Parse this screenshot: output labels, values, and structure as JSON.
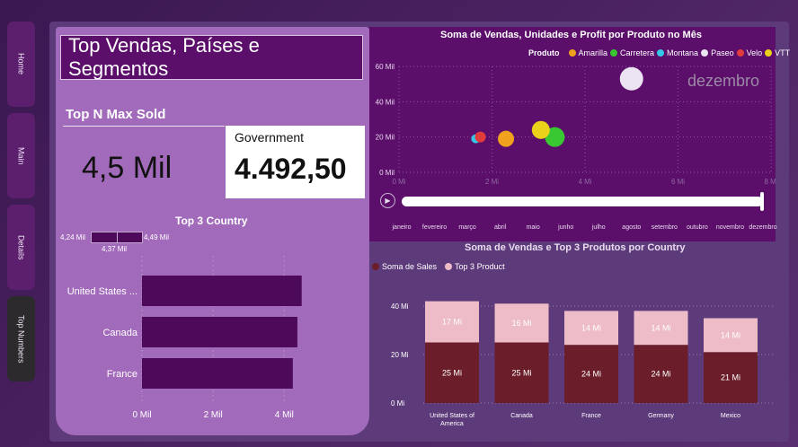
{
  "nav": [
    "Home",
    "Main",
    "Details",
    "Top Numbers"
  ],
  "title": "Top Vendas, Países e Segmentos",
  "topn": {
    "label": "Top N Max Sold",
    "value": "4,5 Mil",
    "segment": "Government",
    "segment_value": "4.492,50"
  },
  "top3_title": "Top 3 Country",
  "mini_labels": [
    "4,24 Mil",
    "4,37 Mil",
    "4,49 Mil"
  ],
  "chart_data": [
    {
      "type": "bar",
      "title": "Top 3 Country",
      "categories": [
        "United States ...",
        "Canada",
        "France"
      ],
      "values": [
        4.49,
        4.37,
        4.24
      ],
      "xticks": [
        "0 Mil",
        "2 Mil",
        "4 Mil"
      ],
      "xlim": [
        0,
        4.75
      ],
      "color": "#4e0a5a"
    },
    {
      "type": "scatter",
      "title": "Soma de Vendas, Unidades e Profit por Produto no Mês",
      "legend_title": "Produto",
      "series": [
        {
          "name": "Amarilla",
          "color": "#f0a11e",
          "x": 2.3,
          "y": 19,
          "size": 9
        },
        {
          "name": "Carretera",
          "color": "#39c832",
          "x": 3.35,
          "y": 20,
          "size": 11
        },
        {
          "name": "Montana",
          "color": "#36c6e8",
          "x": 1.65,
          "y": 19,
          "size": 5
        },
        {
          "name": "Paseo",
          "color": "#ece3f2",
          "x": 5.0,
          "y": 53,
          "size": 13
        },
        {
          "name": "Velo",
          "color": "#e23b3b",
          "x": 1.75,
          "y": 20,
          "size": 6
        },
        {
          "name": "VTT",
          "color": "#ead21a",
          "x": 3.05,
          "y": 24,
          "size": 10
        }
      ],
      "xticks": [
        "0 Mi",
        "2 Mi",
        "4 Mi",
        "6 Mi",
        "8 Mi"
      ],
      "yticks": [
        "0 Mil",
        "20 Mil",
        "40 Mil",
        "60 Mil"
      ],
      "xlim": [
        0,
        8
      ],
      "ylim": [
        0,
        60
      ],
      "current_month": "dezembro",
      "months": [
        "janeiro",
        "fevereiro",
        "março",
        "abril",
        "maio",
        "junho",
        "julho",
        "agosto",
        "setembro",
        "outubro",
        "novembro",
        "dezembro"
      ]
    },
    {
      "type": "bar",
      "title": "Soma de Vendas e Top 3 Produtos por Country",
      "categories": [
        "United States of America",
        "Canada",
        "France",
        "Germany",
        "Mexico"
      ],
      "series": [
        {
          "name": "Soma de  Sales",
          "color": "#6b1e2a",
          "values": [
            25,
            25,
            24,
            24,
            21
          ],
          "labels": [
            "25 Mi",
            "25 Mi",
            "24 Mi",
            "24 Mi",
            "21 Mi"
          ]
        },
        {
          "name": "Top 3 Product",
          "color": "#edbcc6",
          "values": [
            17,
            16,
            14,
            14,
            14
          ],
          "labels": [
            "17 Mi",
            "16 Mi",
            "14 Mi",
            "14 Mi",
            "14 Mi"
          ]
        }
      ],
      "yticks": [
        "0 Mi",
        "20 Mi",
        "40 Mi"
      ],
      "ylim": [
        0,
        40
      ]
    }
  ]
}
